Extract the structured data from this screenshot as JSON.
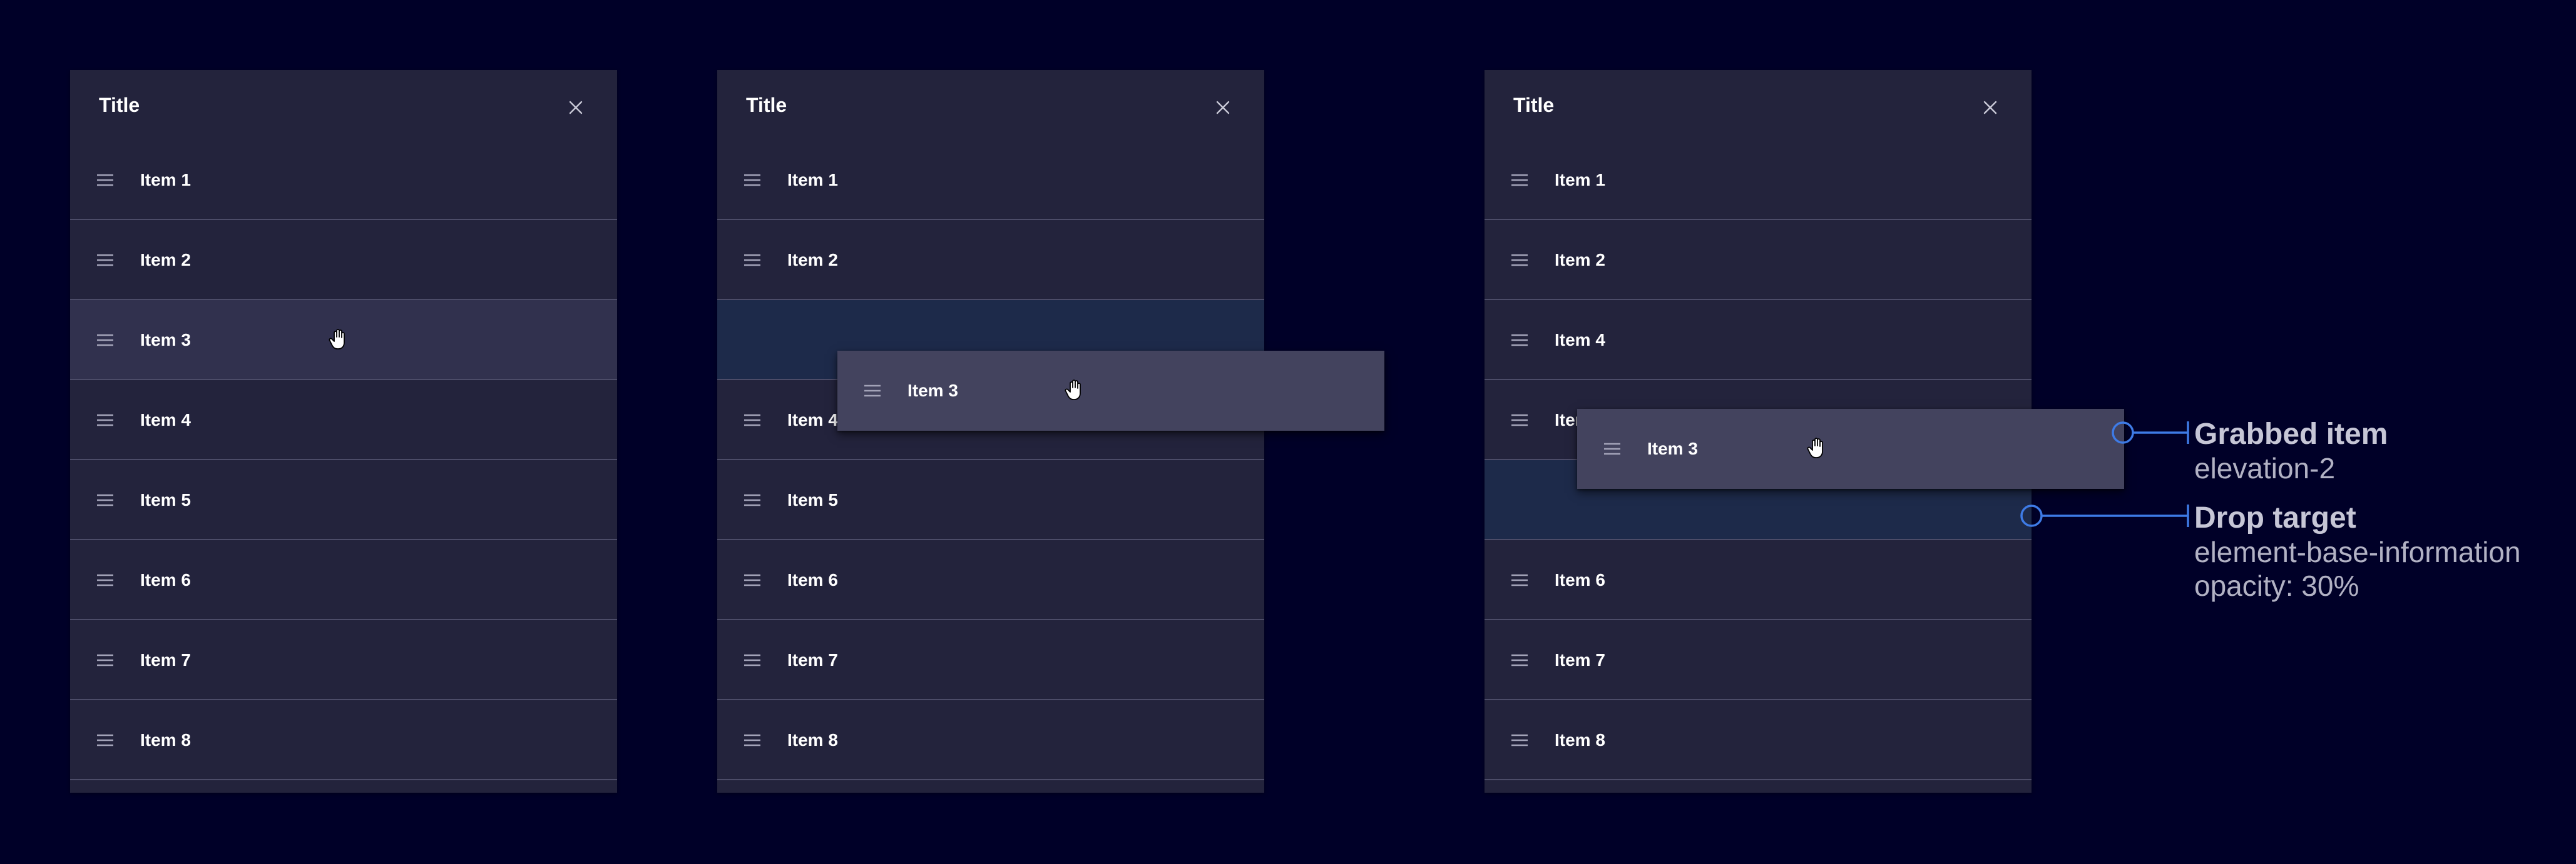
{
  "panels": [
    {
      "title": "Title",
      "items": [
        "Item 1",
        "Item 2",
        "Item 3",
        "Item 4",
        "Item 5",
        "Item 6",
        "Item 7",
        "Item 8"
      ]
    },
    {
      "title": "Title",
      "items": [
        "Item 1",
        "Item 2",
        "",
        "Item 4",
        "Item 5",
        "Item 6",
        "Item 7",
        "Item 8"
      ],
      "grabbed_item": "Item 3"
    },
    {
      "title": "Title",
      "items": [
        "Item 1",
        "Item 2",
        "Item 4",
        "Item 5",
        "",
        "Item 6",
        "Item 7",
        "Item 8"
      ],
      "grabbed_item": "Item 3"
    }
  ],
  "annotations": {
    "grabbed": {
      "title": "Grabbed item",
      "subtitle": "elevation-2"
    },
    "drop": {
      "title": "Drop target",
      "line1": "element-base-information",
      "line2": "opacity: 30%"
    }
  },
  "icons": {
    "drag_handle": "drag-handle-icon",
    "close": "close-icon",
    "cursor": "grab-hand-cursor-icon"
  },
  "colors": {
    "background": "#000028",
    "panel": "#23233c",
    "row_divider": "#4c4c68",
    "hover_row": "#31314e",
    "grabbed_item": "#43435e",
    "drop_target": "#1d2a4a",
    "annotation_line": "#3e7be6",
    "annotation_text": "#c6c6d6"
  }
}
